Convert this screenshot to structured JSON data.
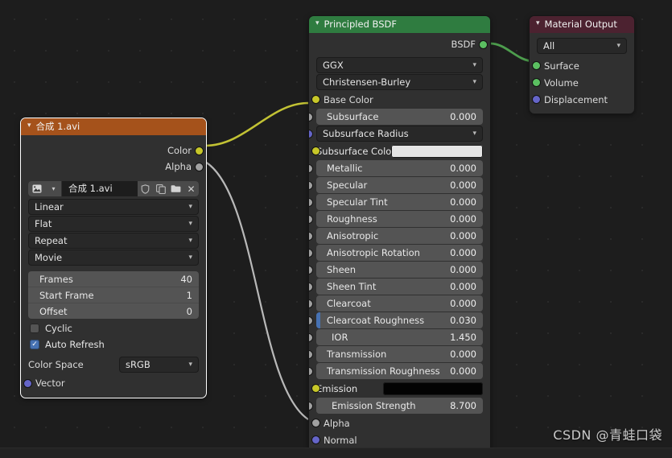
{
  "app": {
    "editor": "shader-node-editor",
    "background": "#1d1d1d",
    "statusbar_text": ""
  },
  "watermark": {
    "text": "CSDN @青蛙口袋"
  },
  "colors": {
    "image_header": "#a5521b",
    "bsdf_header": "#2f7c40",
    "output_header": "#4c2230",
    "socket_color": "#c7c729",
    "socket_shader": "#5bbf61",
    "socket_vector": "#6565c8",
    "socket_value": "#a1a1a1",
    "slider_fill": "#4772b3",
    "wire_color": "#c2c234",
    "wire_gray": "#b9b9b9",
    "wire_shader": "#4d9d4d"
  },
  "image_node": {
    "title": "合成 1.avi",
    "outputs": [
      {
        "label": "Color",
        "socket": "color"
      },
      {
        "label": "Alpha",
        "socket": "value"
      }
    ],
    "file_row": {
      "datablock_icon": "image-icon",
      "browse_icon": "chevron-down-icon",
      "name": "合成 1.avi",
      "buttons": [
        {
          "icon": "shield-icon",
          "label": "⬡"
        },
        {
          "icon": "duplicate-icon",
          "label": "⧉"
        },
        {
          "icon": "folder-icon",
          "label": "▰"
        },
        {
          "icon": "close-icon",
          "label": "✕"
        }
      ]
    },
    "dropdowns": [
      {
        "name": "interpolation",
        "value": "Linear"
      },
      {
        "name": "projection",
        "value": "Flat"
      },
      {
        "name": "extension",
        "value": "Repeat"
      },
      {
        "name": "source",
        "value": "Movie"
      }
    ],
    "numbers": [
      {
        "label": "Frames",
        "value": "40"
      },
      {
        "label": "Start Frame",
        "value": "1"
      },
      {
        "label": "Offset",
        "value": "0"
      }
    ],
    "checkboxes": [
      {
        "label": "Cyclic",
        "checked": false
      },
      {
        "label": "Auto Refresh",
        "checked": true
      }
    ],
    "color_space": {
      "label": "Color Space",
      "value": "sRGB"
    },
    "inputs": [
      {
        "label": "Vector",
        "socket": "vector"
      }
    ]
  },
  "bsdf_node": {
    "title": "Principled BSDF",
    "output": {
      "label": "BSDF",
      "socket": "shader"
    },
    "dropdowns": [
      {
        "name": "distribution",
        "value": "GGX"
      },
      {
        "name": "subsurface-method",
        "value": "Christensen-Burley"
      }
    ],
    "inputs": [
      {
        "label": "Base Color",
        "kind": "label",
        "socket": "color"
      },
      {
        "label": "Subsurface",
        "kind": "slider",
        "value": "0.000",
        "fill": 0,
        "socket": "value"
      },
      {
        "label": "Subsurface Radius",
        "kind": "dropdown",
        "socket": "vector"
      },
      {
        "label": "Subsurface Colo",
        "kind": "swatch",
        "swatch_color": "#e4e4e4",
        "socket": "color"
      },
      {
        "label": "Metallic",
        "kind": "slider",
        "value": "0.000",
        "fill": 0,
        "socket": "value"
      },
      {
        "label": "Specular",
        "kind": "slider",
        "value": "0.000",
        "fill": 0,
        "socket": "value"
      },
      {
        "label": "Specular Tint",
        "kind": "slider",
        "value": "0.000",
        "fill": 0,
        "socket": "value"
      },
      {
        "label": "Roughness",
        "kind": "slider",
        "value": "0.000",
        "fill": 0,
        "socket": "value"
      },
      {
        "label": "Anisotropic",
        "kind": "slider",
        "value": "0.000",
        "fill": 0,
        "socket": "value"
      },
      {
        "label": "Anisotropic Rotation",
        "kind": "slider",
        "value": "0.000",
        "fill": 0,
        "socket": "value"
      },
      {
        "label": "Sheen",
        "kind": "slider",
        "value": "0.000",
        "fill": 0,
        "socket": "value"
      },
      {
        "label": "Sheen Tint",
        "kind": "slider",
        "value": "0.000",
        "fill": 0,
        "socket": "value"
      },
      {
        "label": "Clearcoat",
        "kind": "slider",
        "value": "0.000",
        "fill": 0,
        "socket": "value"
      },
      {
        "label": "Clearcoat Roughness",
        "kind": "slider",
        "value": "0.030",
        "fill": 3,
        "socket": "value"
      },
      {
        "label": "IOR",
        "kind": "slider",
        "value": "1.450",
        "fill": 0,
        "socket": "value",
        "indent": true
      },
      {
        "label": "Transmission",
        "kind": "slider",
        "value": "0.000",
        "fill": 0,
        "socket": "value"
      },
      {
        "label": "Transmission Roughness",
        "kind": "slider",
        "value": "0.000",
        "fill": 0,
        "socket": "value"
      },
      {
        "label": "Emission",
        "kind": "swatch",
        "swatch_color": "#030303",
        "socket": "color"
      },
      {
        "label": "Emission Strength",
        "kind": "slider",
        "value": "8.700",
        "fill": 0,
        "socket": "value",
        "indent": true
      },
      {
        "label": "Alpha",
        "kind": "label",
        "socket": "value"
      },
      {
        "label": "Normal",
        "kind": "label",
        "socket": "vector"
      }
    ]
  },
  "output_node": {
    "title": "Material Output",
    "target": {
      "name": "target",
      "value": "All"
    },
    "inputs": [
      {
        "label": "Surface",
        "socket": "shader"
      },
      {
        "label": "Volume",
        "socket": "shader"
      },
      {
        "label": "Displacement",
        "socket": "vector"
      }
    ]
  },
  "links": [
    {
      "from": "image.Color",
      "to": "bsdf.Base Color",
      "color": "#c2c234"
    },
    {
      "from": "image.Alpha",
      "to": "bsdf.Alpha",
      "color": "#b9b9b9"
    },
    {
      "from": "bsdf.BSDF",
      "to": "output.Surface",
      "color": "#4d9d4d"
    }
  ]
}
